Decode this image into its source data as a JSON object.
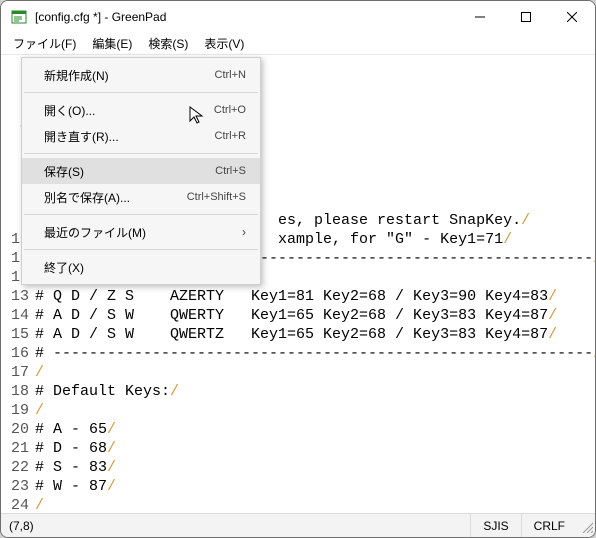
{
  "title": "[config.cfg *] - GreenPad",
  "menubar": [
    "ファイル(F)",
    "編集(E)",
    "検索(S)",
    "表示(V)"
  ],
  "file_menu": [
    {
      "label": "新規作成(N)",
      "accel": "Ctrl+N",
      "kind": "item"
    },
    {
      "kind": "sep"
    },
    {
      "label": "開く(O)...",
      "accel": "Ctrl+O",
      "kind": "item"
    },
    {
      "label": "開き直す(R)...",
      "accel": "Ctrl+R",
      "kind": "item"
    },
    {
      "kind": "sep"
    },
    {
      "label": "保存(S)",
      "accel": "Ctrl+S",
      "kind": "item",
      "hover": true
    },
    {
      "label": "別名で保存(A)...",
      "accel": "Ctrl+Shift+S",
      "kind": "item"
    },
    {
      "kind": "sep"
    },
    {
      "label": "最近のファイル(M)",
      "kind": "submenu"
    },
    {
      "kind": "sep"
    },
    {
      "label": "終了(X)",
      "kind": "item"
    }
  ],
  "editor": {
    "first_line": 1,
    "lines": [
      "",
      "",
      "",
      "",
      "",
      "",
      "",
      "",
      "                           es, please restart SnapKey.",
      "                           xample, for \"G\" - Key1=71",
      "# ------------------------------------------------------------",
      "#",
      "# Q D / Z S    AZERTY   Key1=81 Key2=68 / Key3=90 Key4=83",
      "# A D / S W    QWERTY   Key1=65 Key2=68 / Key3=83 Key4=87",
      "# A D / S W    QWERTZ   Key1=65 Key2=68 / Key3=83 Key4=87",
      "# ------------------------------------------------------------",
      "",
      "# Default Keys:",
      "",
      "# A - 65",
      "# D - 68",
      "# S - 83",
      "# W - 87",
      ""
    ]
  },
  "status": {
    "pos": "(7,8)",
    "encoding": "SJIS",
    "lineend": "CRLF"
  }
}
